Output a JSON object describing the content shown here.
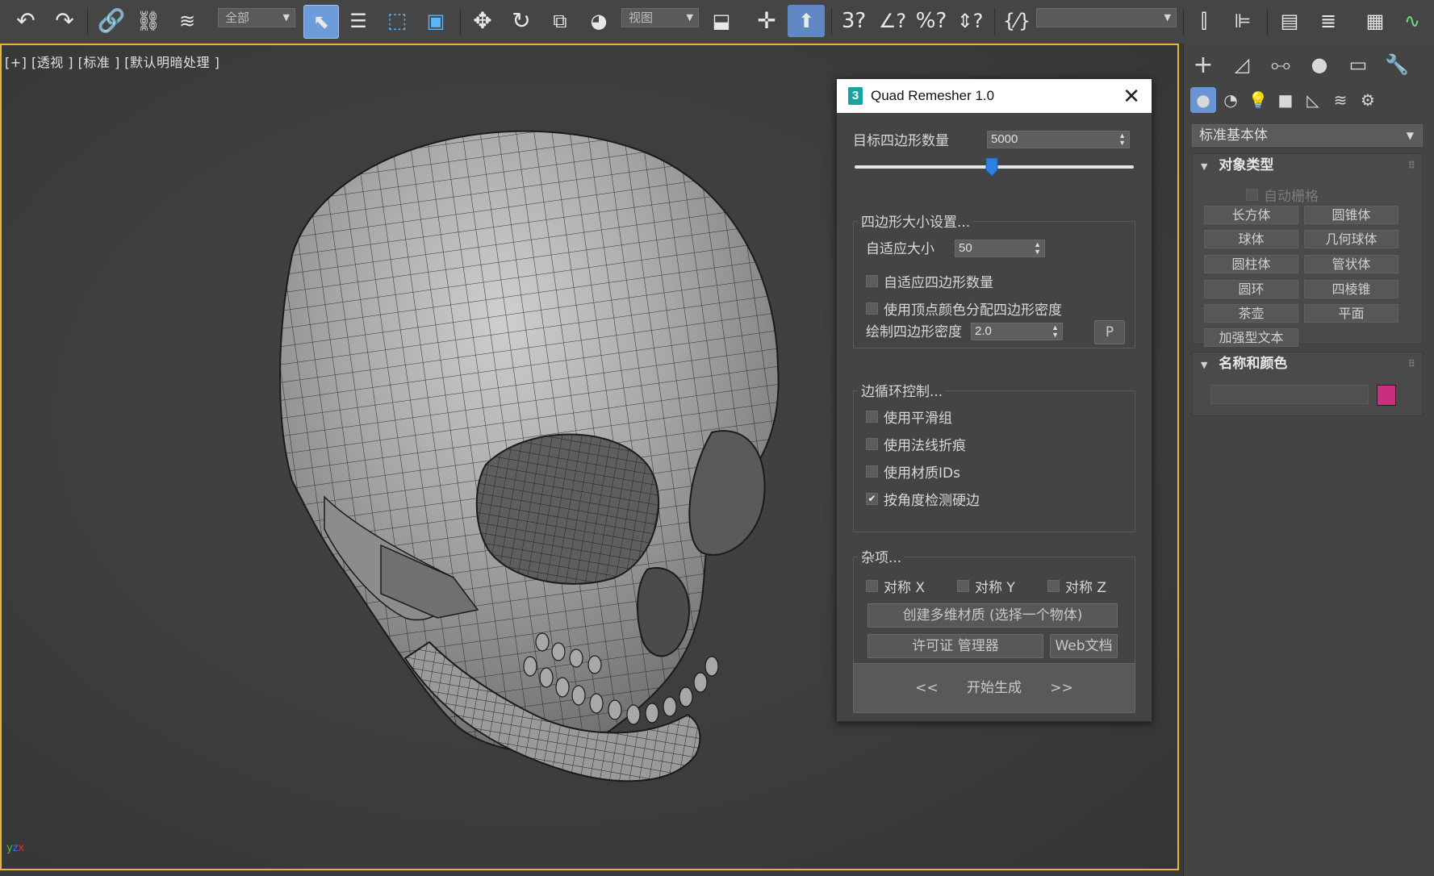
{
  "toolbar": {
    "selection_filter": "全部",
    "reference_coord": "视图",
    "named_selection": ""
  },
  "viewport": {
    "label": "[+] [透视 ] [标准 ] [默认明暗处理 ]"
  },
  "dialog": {
    "title": "Quad Remesher 1.0",
    "target_quad_label": "目标四边形数量",
    "target_quad_value": "5000",
    "slider_fraction": 0.49,
    "quad_size_group": "四边形大小设置...",
    "adaptive_size_label": "自适应大小",
    "adaptive_size_value": "50",
    "adaptive_quad_count": "自适应四边形数量",
    "use_vertex_color": "使用顶点颜色分配四边形密度",
    "paint_density_label": "绘制四边形密度",
    "paint_density_value": "2.0",
    "p_button": "P",
    "edge_loop_group": "边循环控制...",
    "use_smoothing_groups": "使用平滑组",
    "use_normal_crease": "使用法线折痕",
    "use_material_ids": "使用材质IDs",
    "detect_hard_edges": "按角度检测硬边",
    "misc_group": "杂项...",
    "symmetry_x": "对称 X",
    "symmetry_y": "对称 Y",
    "symmetry_z": "对称 Z",
    "create_multi_material": "创建多维材质 (选择一个物体)",
    "license_manager": "许可证 管理器",
    "web_docs": "Web文档",
    "generate_left": "<<",
    "generate_label": "开始生成",
    "generate_right": ">>"
  },
  "command_panel": {
    "category_dropdown": "标准基本体",
    "object_type_title": "对象类型",
    "auto_grid": "自动栅格",
    "buttons": [
      "长方体",
      "圆锥体",
      "球体",
      "几何球体",
      "圆柱体",
      "管状体",
      "圆环",
      "四棱锥",
      "茶壶",
      "平面",
      "加强型文本"
    ],
    "name_color_title": "名称和颜色",
    "object_name_value": "",
    "object_color": "#c8307f"
  },
  "colors": {
    "accent_selected": "#5f88c4",
    "viewport_border": "#e8b53c"
  }
}
